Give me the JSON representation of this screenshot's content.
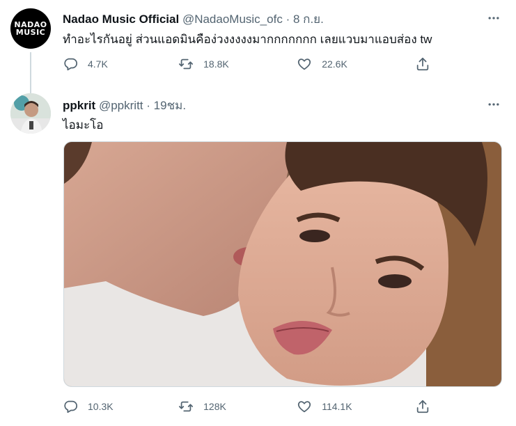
{
  "tweets": [
    {
      "avatar_text": [
        "NADAO",
        "MUSIC"
      ],
      "name": "Nadao Music Official",
      "handle": "@NadaoMusic_ofc",
      "separator": "·",
      "time": "8 ก.ย.",
      "text": "ทำอะไรกันอยู่ ส่วนแอดมินคือง่วงงงงงมากกกกกกก เลยแวบมาแอบส่อง tw",
      "stats": {
        "replies": "4.7K",
        "retweets": "18.8K",
        "likes": "22.6K"
      }
    },
    {
      "name": "ppkrit",
      "handle": "@ppkritt",
      "separator": "·",
      "time": "19ชม.",
      "text": "ไอมะโอ",
      "stats": {
        "replies": "10.3K",
        "retweets": "128K",
        "likes": "114.1K"
      }
    }
  ],
  "icons": {
    "more": "more-dots-icon",
    "reply": "reply-bubble-icon",
    "retweet": "retweet-arrows-icon",
    "like": "heart-icon",
    "share": "share-upload-icon"
  },
  "colors": {
    "text_primary": "#0f1419",
    "text_secondary": "#536471",
    "divider": "#cfd9de"
  }
}
